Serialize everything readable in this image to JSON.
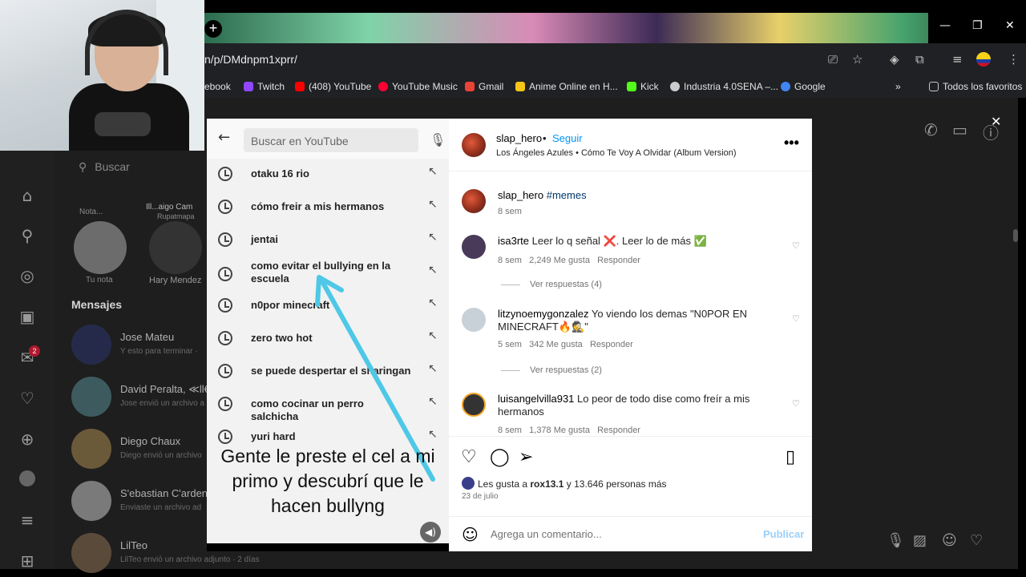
{
  "browser": {
    "url": "n/p/DMdnpm1xprr/",
    "new_tab": "+",
    "bookmarks": [
      {
        "label": "ebook",
        "color": "#1877f2"
      },
      {
        "label": "Twitch",
        "color": "#9146ff"
      },
      {
        "label": "(408) YouTube",
        "color": "#ff0000"
      },
      {
        "label": "YouTube Music",
        "color": "#ff0033"
      },
      {
        "label": "Gmail",
        "color": "#ea4335"
      },
      {
        "label": "Anime Online en H...",
        "color": "#f5c518"
      },
      {
        "label": "Kick",
        "color": "#53fc18"
      },
      {
        "label": "Industria 4.0SENA –...",
        "color": "#cccccc"
      },
      {
        "label": "Google",
        "color": "#4285f4"
      }
    ],
    "overflow": "»",
    "all_favorites": "Todos los favoritos"
  },
  "instagram_bg": {
    "search_placeholder": "Buscar",
    "notes": [
      {
        "label": "Nota...",
        "sub": "Tu nota"
      },
      {
        "label": "Ill...aigo Cam",
        "sub": "Hary Mendez"
      }
    ],
    "note_extra": "Rupatmapa",
    "messages_title": "Mensajes",
    "chats": [
      {
        "name": "Jose Mateu",
        "preview": "Y esto para terminar ·"
      },
      {
        "name": "David Peralta, ≪ll€",
        "preview": "Jose envió un archivo a"
      },
      {
        "name": "Diego Chaux",
        "preview": "Diego envió un archivo"
      },
      {
        "name": "S'ebastian C'ardena",
        "preview": "Enviaste un archivo ad"
      },
      {
        "name": "LilTeo",
        "preview": "LilTeo envió un archivo adjunto · 2 días"
      }
    ],
    "notification_count": "2"
  },
  "video": {
    "search_placeholder": "Buscar en YouTube",
    "suggestions": [
      "otaku 16 rio",
      "cómo freir a mis hermanos",
      "jentai",
      "como evitar el bullying en la escuela",
      "n0por minecraft",
      "zero two hot",
      "se puede despertar el sharingan",
      "como cocinar un perro salchicha",
      "yuri hard"
    ],
    "caption": "Gente le preste el cel a mi primo y descubrí que le hacen bullyng"
  },
  "post": {
    "username": "slap_hero",
    "separator": "•",
    "follow": "Seguir",
    "song": "Los Ángeles Azules • Cómo Te Voy A Olvidar (Album Version)",
    "more": "•••",
    "caption_user": "slap_hero",
    "caption_text": "#memes",
    "caption_time": "8 sem",
    "comments": [
      {
        "user": "isa3rte",
        "text": "Leer lo q señal ❌. Leer lo de más ✅",
        "time": "8 sem",
        "likes": "2,249 Me gusta",
        "reply": "Responder",
        "replies": "Ver respuestas (4)"
      },
      {
        "user": "litzynoemygonzalez",
        "text": "Yo viendo los demas \"N0POR EN MINECRAFT🔥🕵\"",
        "time": "5 sem",
        "likes": "342 Me gusta",
        "reply": "Responder",
        "replies": "Ver respuestas (2)"
      },
      {
        "user": "luisangelvilla931",
        "text": "Lo peor de todo dise como freír a mis hermanos",
        "time": "8 sem",
        "likes": "1,378 Me gusta",
        "reply": "Responder"
      }
    ],
    "likes_prefix": "Les gusta a",
    "likes_user": "rox13.1",
    "likes_suffix": "y 13.646 personas más",
    "date": "23 de julio",
    "comment_placeholder": "Agrega un comentario...",
    "publish": "Publicar"
  },
  "icons": {
    "heart": "♡",
    "chat": "◯",
    "send": "➢",
    "bookmark": "▯",
    "emoji": "☺",
    "mute": "◀)",
    "back": "←",
    "mic": "🎙",
    "fill_arrow": "↖"
  }
}
